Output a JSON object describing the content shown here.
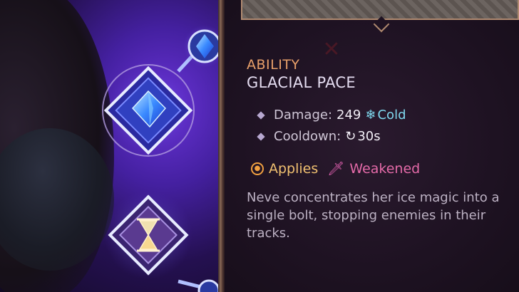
{
  "tooltip": {
    "category": "ABILITY",
    "name": "GLACIAL PACE",
    "stats": [
      {
        "label": "Damage:",
        "value": "249",
        "element": "Cold"
      },
      {
        "label": "Cooldown:",
        "value": "30s"
      }
    ],
    "applies_label": "Applies",
    "status_effect": "Weakened",
    "description": "Neve concentrates her ice magic into a single bolt, stopping enemies in their tracks."
  },
  "colors": {
    "category": "#e8a06a",
    "title": "#e4dcf0",
    "cold": "#7fd8ee",
    "applies": "#f0c070",
    "weakened": "#e46aa8",
    "panel_bg": "#1e1222"
  },
  "icons": [
    "crystal-skill-icon",
    "hourglass-skill-icon",
    "snowflake-icon",
    "cooldown-icon",
    "applies-icon",
    "weakened-icon"
  ]
}
